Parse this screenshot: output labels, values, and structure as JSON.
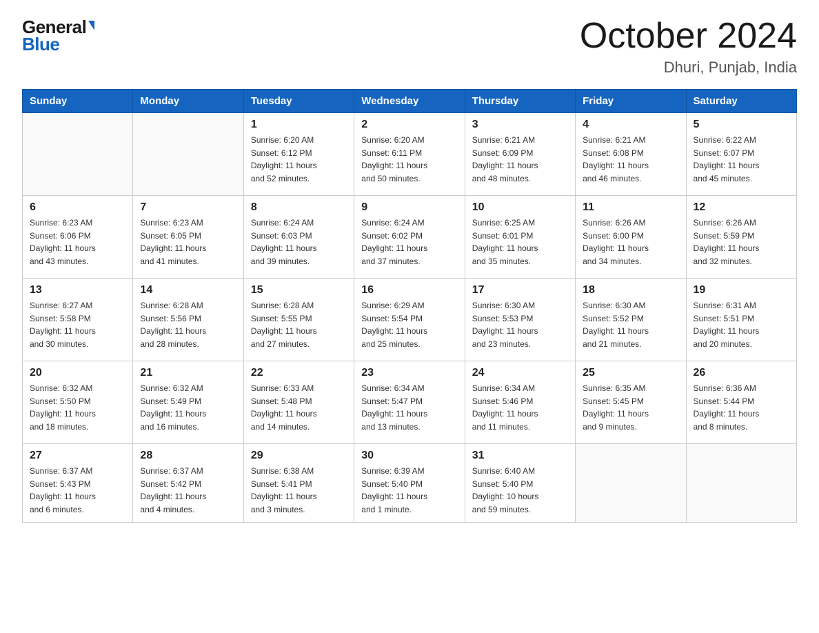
{
  "logo": {
    "general": "General",
    "blue": "Blue"
  },
  "title": "October 2024",
  "subtitle": "Dhuri, Punjab, India",
  "days_of_week": [
    "Sunday",
    "Monday",
    "Tuesday",
    "Wednesday",
    "Thursday",
    "Friday",
    "Saturday"
  ],
  "weeks": [
    [
      {
        "day": "",
        "info": ""
      },
      {
        "day": "",
        "info": ""
      },
      {
        "day": "1",
        "info": "Sunrise: 6:20 AM\nSunset: 6:12 PM\nDaylight: 11 hours\nand 52 minutes."
      },
      {
        "day": "2",
        "info": "Sunrise: 6:20 AM\nSunset: 6:11 PM\nDaylight: 11 hours\nand 50 minutes."
      },
      {
        "day": "3",
        "info": "Sunrise: 6:21 AM\nSunset: 6:09 PM\nDaylight: 11 hours\nand 48 minutes."
      },
      {
        "day": "4",
        "info": "Sunrise: 6:21 AM\nSunset: 6:08 PM\nDaylight: 11 hours\nand 46 minutes."
      },
      {
        "day": "5",
        "info": "Sunrise: 6:22 AM\nSunset: 6:07 PM\nDaylight: 11 hours\nand 45 minutes."
      }
    ],
    [
      {
        "day": "6",
        "info": "Sunrise: 6:23 AM\nSunset: 6:06 PM\nDaylight: 11 hours\nand 43 minutes."
      },
      {
        "day": "7",
        "info": "Sunrise: 6:23 AM\nSunset: 6:05 PM\nDaylight: 11 hours\nand 41 minutes."
      },
      {
        "day": "8",
        "info": "Sunrise: 6:24 AM\nSunset: 6:03 PM\nDaylight: 11 hours\nand 39 minutes."
      },
      {
        "day": "9",
        "info": "Sunrise: 6:24 AM\nSunset: 6:02 PM\nDaylight: 11 hours\nand 37 minutes."
      },
      {
        "day": "10",
        "info": "Sunrise: 6:25 AM\nSunset: 6:01 PM\nDaylight: 11 hours\nand 35 minutes."
      },
      {
        "day": "11",
        "info": "Sunrise: 6:26 AM\nSunset: 6:00 PM\nDaylight: 11 hours\nand 34 minutes."
      },
      {
        "day": "12",
        "info": "Sunrise: 6:26 AM\nSunset: 5:59 PM\nDaylight: 11 hours\nand 32 minutes."
      }
    ],
    [
      {
        "day": "13",
        "info": "Sunrise: 6:27 AM\nSunset: 5:58 PM\nDaylight: 11 hours\nand 30 minutes."
      },
      {
        "day": "14",
        "info": "Sunrise: 6:28 AM\nSunset: 5:56 PM\nDaylight: 11 hours\nand 28 minutes."
      },
      {
        "day": "15",
        "info": "Sunrise: 6:28 AM\nSunset: 5:55 PM\nDaylight: 11 hours\nand 27 minutes."
      },
      {
        "day": "16",
        "info": "Sunrise: 6:29 AM\nSunset: 5:54 PM\nDaylight: 11 hours\nand 25 minutes."
      },
      {
        "day": "17",
        "info": "Sunrise: 6:30 AM\nSunset: 5:53 PM\nDaylight: 11 hours\nand 23 minutes."
      },
      {
        "day": "18",
        "info": "Sunrise: 6:30 AM\nSunset: 5:52 PM\nDaylight: 11 hours\nand 21 minutes."
      },
      {
        "day": "19",
        "info": "Sunrise: 6:31 AM\nSunset: 5:51 PM\nDaylight: 11 hours\nand 20 minutes."
      }
    ],
    [
      {
        "day": "20",
        "info": "Sunrise: 6:32 AM\nSunset: 5:50 PM\nDaylight: 11 hours\nand 18 minutes."
      },
      {
        "day": "21",
        "info": "Sunrise: 6:32 AM\nSunset: 5:49 PM\nDaylight: 11 hours\nand 16 minutes."
      },
      {
        "day": "22",
        "info": "Sunrise: 6:33 AM\nSunset: 5:48 PM\nDaylight: 11 hours\nand 14 minutes."
      },
      {
        "day": "23",
        "info": "Sunrise: 6:34 AM\nSunset: 5:47 PM\nDaylight: 11 hours\nand 13 minutes."
      },
      {
        "day": "24",
        "info": "Sunrise: 6:34 AM\nSunset: 5:46 PM\nDaylight: 11 hours\nand 11 minutes."
      },
      {
        "day": "25",
        "info": "Sunrise: 6:35 AM\nSunset: 5:45 PM\nDaylight: 11 hours\nand 9 minutes."
      },
      {
        "day": "26",
        "info": "Sunrise: 6:36 AM\nSunset: 5:44 PM\nDaylight: 11 hours\nand 8 minutes."
      }
    ],
    [
      {
        "day": "27",
        "info": "Sunrise: 6:37 AM\nSunset: 5:43 PM\nDaylight: 11 hours\nand 6 minutes."
      },
      {
        "day": "28",
        "info": "Sunrise: 6:37 AM\nSunset: 5:42 PM\nDaylight: 11 hours\nand 4 minutes."
      },
      {
        "day": "29",
        "info": "Sunrise: 6:38 AM\nSunset: 5:41 PM\nDaylight: 11 hours\nand 3 minutes."
      },
      {
        "day": "30",
        "info": "Sunrise: 6:39 AM\nSunset: 5:40 PM\nDaylight: 11 hours\nand 1 minute."
      },
      {
        "day": "31",
        "info": "Sunrise: 6:40 AM\nSunset: 5:40 PM\nDaylight: 10 hours\nand 59 minutes."
      },
      {
        "day": "",
        "info": ""
      },
      {
        "day": "",
        "info": ""
      }
    ]
  ]
}
